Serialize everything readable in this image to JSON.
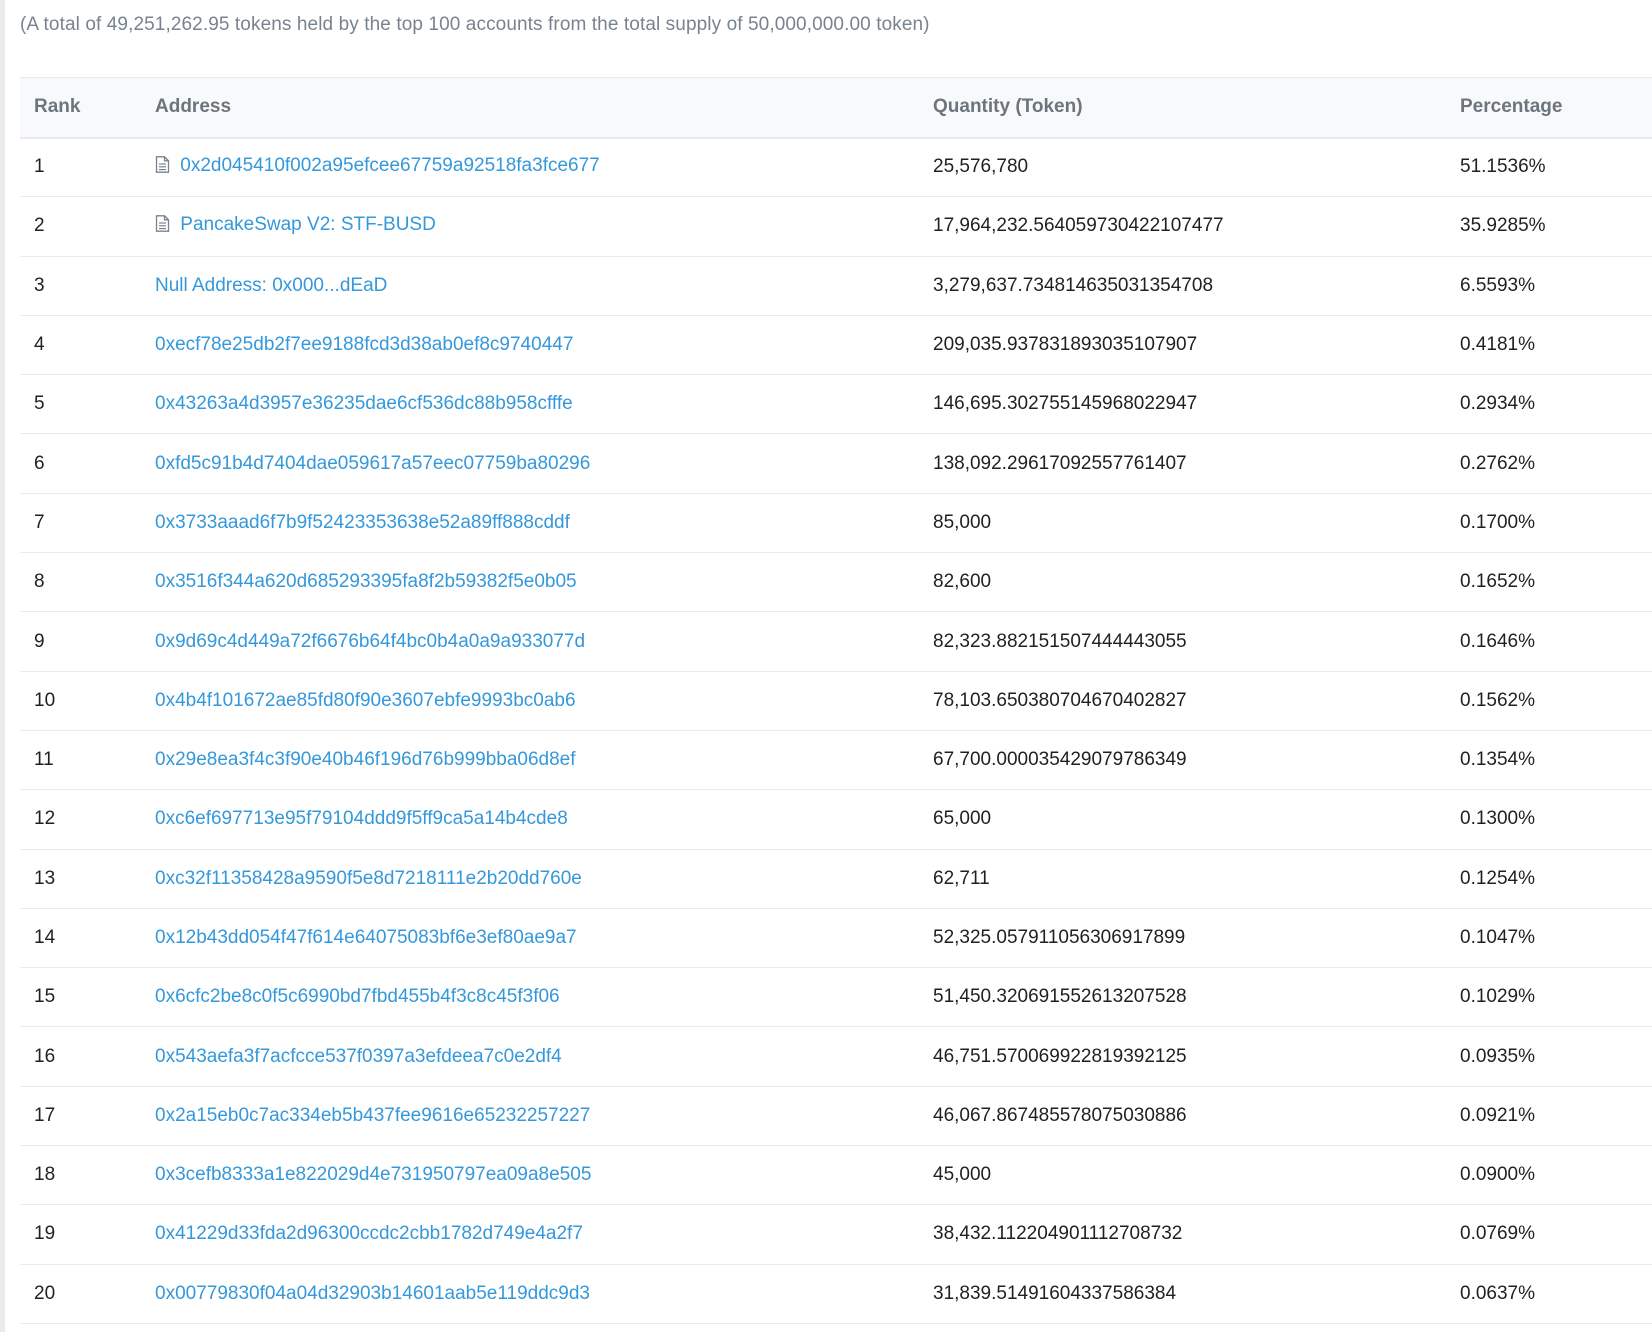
{
  "summary": "(A total of 49,251,262.95 tokens held by the top 100 accounts from the total supply of 50,000,000.00 token)",
  "table": {
    "headers": {
      "rank": "Rank",
      "address": "Address",
      "quantity": "Quantity (Token)",
      "percentage": "Percentage"
    },
    "rows": [
      {
        "rank": "1",
        "address": "0x2d045410f002a95efcee67759a92518fa3fce677",
        "is_contract": true,
        "quantity": "25,576,780",
        "percentage": "51.1536%"
      },
      {
        "rank": "2",
        "address": "PancakeSwap V2: STF-BUSD",
        "is_contract": true,
        "quantity": "17,964,232.564059730422107477",
        "percentage": "35.9285%"
      },
      {
        "rank": "3",
        "address": "Null Address: 0x000...dEaD",
        "is_contract": false,
        "quantity": "3,279,637.734814635031354708",
        "percentage": "6.5593%"
      },
      {
        "rank": "4",
        "address": "0xecf78e25db2f7ee9188fcd3d38ab0ef8c9740447",
        "is_contract": false,
        "quantity": "209,035.937831893035107907",
        "percentage": "0.4181%"
      },
      {
        "rank": "5",
        "address": "0x43263a4d3957e36235dae6cf536dc88b958cfffe",
        "is_contract": false,
        "quantity": "146,695.302755145968022947",
        "percentage": "0.2934%"
      },
      {
        "rank": "6",
        "address": "0xfd5c91b4d7404dae059617a57eec07759ba80296",
        "is_contract": false,
        "quantity": "138,092.29617092557761407",
        "percentage": "0.2762%"
      },
      {
        "rank": "7",
        "address": "0x3733aaad6f7b9f52423353638e52a89ff888cddf",
        "is_contract": false,
        "quantity": "85,000",
        "percentage": "0.1700%"
      },
      {
        "rank": "8",
        "address": "0x3516f344a620d685293395fa8f2b59382f5e0b05",
        "is_contract": false,
        "quantity": "82,600",
        "percentage": "0.1652%"
      },
      {
        "rank": "9",
        "address": "0x9d69c4d449a72f6676b64f4bc0b4a0a9a933077d",
        "is_contract": false,
        "quantity": "82,323.882151507444443055",
        "percentage": "0.1646%"
      },
      {
        "rank": "10",
        "address": "0x4b4f101672ae85fd80f90e3607ebfe9993bc0ab6",
        "is_contract": false,
        "quantity": "78,103.650380704670402827",
        "percentage": "0.1562%"
      },
      {
        "rank": "11",
        "address": "0x29e8ea3f4c3f90e40b46f196d76b999bba06d8ef",
        "is_contract": false,
        "quantity": "67,700.000035429079786349",
        "percentage": "0.1354%"
      },
      {
        "rank": "12",
        "address": "0xc6ef697713e95f79104ddd9f5ff9ca5a14b4cde8",
        "is_contract": false,
        "quantity": "65,000",
        "percentage": "0.1300%"
      },
      {
        "rank": "13",
        "address": "0xc32f11358428a9590f5e8d7218111e2b20dd760e",
        "is_contract": false,
        "quantity": "62,711",
        "percentage": "0.1254%"
      },
      {
        "rank": "14",
        "address": "0x12b43dd054f47f614e64075083bf6e3ef80ae9a7",
        "is_contract": false,
        "quantity": "52,325.057911056306917899",
        "percentage": "0.1047%"
      },
      {
        "rank": "15",
        "address": "0x6cfc2be8c0f5c6990bd7fbd455b4f3c8c45f3f06",
        "is_contract": false,
        "quantity": "51,450.320691552613207528",
        "percentage": "0.1029%"
      },
      {
        "rank": "16",
        "address": "0x543aefa3f7acfcce537f0397a3efdeea7c0e2df4",
        "is_contract": false,
        "quantity": "46,751.570069922819392125",
        "percentage": "0.0935%"
      },
      {
        "rank": "17",
        "address": "0x2a15eb0c7ac334eb5b437fee9616e65232257227",
        "is_contract": false,
        "quantity": "46,067.867485578075030886",
        "percentage": "0.0921%"
      },
      {
        "rank": "18",
        "address": "0x3cefb8333a1e822029d4e731950797ea09a8e505",
        "is_contract": false,
        "quantity": "45,000",
        "percentage": "0.0900%"
      },
      {
        "rank": "19",
        "address": "0x41229d33fda2d96300ccdc2cbb1782d749e4a2f7",
        "is_contract": false,
        "quantity": "38,432.112204901112708732",
        "percentage": "0.0769%"
      },
      {
        "rank": "20",
        "address": "0x00779830f04a04d32903b14601aab5e119ddc9d3",
        "is_contract": false,
        "quantity": "31,839.51491604337586384",
        "percentage": "0.0637%"
      }
    ]
  },
  "colors": {
    "link": "#3498db",
    "text": "#1e2022",
    "muted": "#77838f",
    "header_bg": "#f8f9fa",
    "border": "#e7eaf3"
  }
}
